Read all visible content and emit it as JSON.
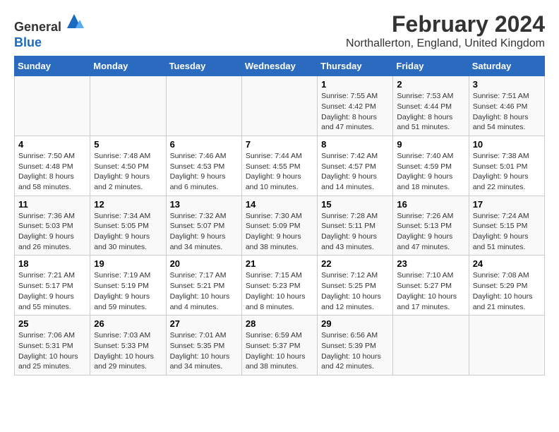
{
  "header": {
    "logo_line1": "General",
    "logo_line2": "Blue",
    "title": "February 2024",
    "subtitle": "Northallerton, England, United Kingdom"
  },
  "calendar": {
    "days_of_week": [
      "Sunday",
      "Monday",
      "Tuesday",
      "Wednesday",
      "Thursday",
      "Friday",
      "Saturday"
    ],
    "weeks": [
      [
        {
          "day": "",
          "info": ""
        },
        {
          "day": "",
          "info": ""
        },
        {
          "day": "",
          "info": ""
        },
        {
          "day": "",
          "info": ""
        },
        {
          "day": "1",
          "info": "Sunrise: 7:55 AM\nSunset: 4:42 PM\nDaylight: 8 hours\nand 47 minutes."
        },
        {
          "day": "2",
          "info": "Sunrise: 7:53 AM\nSunset: 4:44 PM\nDaylight: 8 hours\nand 51 minutes."
        },
        {
          "day": "3",
          "info": "Sunrise: 7:51 AM\nSunset: 4:46 PM\nDaylight: 8 hours\nand 54 minutes."
        }
      ],
      [
        {
          "day": "4",
          "info": "Sunrise: 7:50 AM\nSunset: 4:48 PM\nDaylight: 8 hours\nand 58 minutes."
        },
        {
          "day": "5",
          "info": "Sunrise: 7:48 AM\nSunset: 4:50 PM\nDaylight: 9 hours\nand 2 minutes."
        },
        {
          "day": "6",
          "info": "Sunrise: 7:46 AM\nSunset: 4:53 PM\nDaylight: 9 hours\nand 6 minutes."
        },
        {
          "day": "7",
          "info": "Sunrise: 7:44 AM\nSunset: 4:55 PM\nDaylight: 9 hours\nand 10 minutes."
        },
        {
          "day": "8",
          "info": "Sunrise: 7:42 AM\nSunset: 4:57 PM\nDaylight: 9 hours\nand 14 minutes."
        },
        {
          "day": "9",
          "info": "Sunrise: 7:40 AM\nSunset: 4:59 PM\nDaylight: 9 hours\nand 18 minutes."
        },
        {
          "day": "10",
          "info": "Sunrise: 7:38 AM\nSunset: 5:01 PM\nDaylight: 9 hours\nand 22 minutes."
        }
      ],
      [
        {
          "day": "11",
          "info": "Sunrise: 7:36 AM\nSunset: 5:03 PM\nDaylight: 9 hours\nand 26 minutes."
        },
        {
          "day": "12",
          "info": "Sunrise: 7:34 AM\nSunset: 5:05 PM\nDaylight: 9 hours\nand 30 minutes."
        },
        {
          "day": "13",
          "info": "Sunrise: 7:32 AM\nSunset: 5:07 PM\nDaylight: 9 hours\nand 34 minutes."
        },
        {
          "day": "14",
          "info": "Sunrise: 7:30 AM\nSunset: 5:09 PM\nDaylight: 9 hours\nand 38 minutes."
        },
        {
          "day": "15",
          "info": "Sunrise: 7:28 AM\nSunset: 5:11 PM\nDaylight: 9 hours\nand 43 minutes."
        },
        {
          "day": "16",
          "info": "Sunrise: 7:26 AM\nSunset: 5:13 PM\nDaylight: 9 hours\nand 47 minutes."
        },
        {
          "day": "17",
          "info": "Sunrise: 7:24 AM\nSunset: 5:15 PM\nDaylight: 9 hours\nand 51 minutes."
        }
      ],
      [
        {
          "day": "18",
          "info": "Sunrise: 7:21 AM\nSunset: 5:17 PM\nDaylight: 9 hours\nand 55 minutes."
        },
        {
          "day": "19",
          "info": "Sunrise: 7:19 AM\nSunset: 5:19 PM\nDaylight: 9 hours\nand 59 minutes."
        },
        {
          "day": "20",
          "info": "Sunrise: 7:17 AM\nSunset: 5:21 PM\nDaylight: 10 hours\nand 4 minutes."
        },
        {
          "day": "21",
          "info": "Sunrise: 7:15 AM\nSunset: 5:23 PM\nDaylight: 10 hours\nand 8 minutes."
        },
        {
          "day": "22",
          "info": "Sunrise: 7:12 AM\nSunset: 5:25 PM\nDaylight: 10 hours\nand 12 minutes."
        },
        {
          "day": "23",
          "info": "Sunrise: 7:10 AM\nSunset: 5:27 PM\nDaylight: 10 hours\nand 17 minutes."
        },
        {
          "day": "24",
          "info": "Sunrise: 7:08 AM\nSunset: 5:29 PM\nDaylight: 10 hours\nand 21 minutes."
        }
      ],
      [
        {
          "day": "25",
          "info": "Sunrise: 7:06 AM\nSunset: 5:31 PM\nDaylight: 10 hours\nand 25 minutes."
        },
        {
          "day": "26",
          "info": "Sunrise: 7:03 AM\nSunset: 5:33 PM\nDaylight: 10 hours\nand 29 minutes."
        },
        {
          "day": "27",
          "info": "Sunrise: 7:01 AM\nSunset: 5:35 PM\nDaylight: 10 hours\nand 34 minutes."
        },
        {
          "day": "28",
          "info": "Sunrise: 6:59 AM\nSunset: 5:37 PM\nDaylight: 10 hours\nand 38 minutes."
        },
        {
          "day": "29",
          "info": "Sunrise: 6:56 AM\nSunset: 5:39 PM\nDaylight: 10 hours\nand 42 minutes."
        },
        {
          "day": "",
          "info": ""
        },
        {
          "day": "",
          "info": ""
        }
      ]
    ]
  }
}
